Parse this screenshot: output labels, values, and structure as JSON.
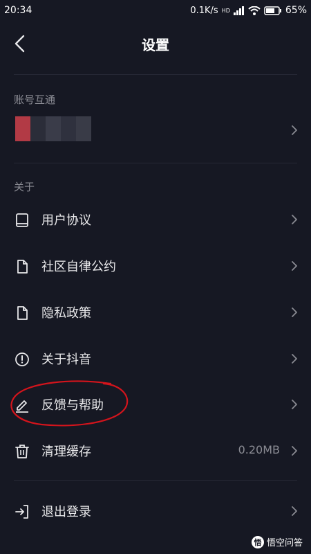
{
  "status_bar": {
    "time": "20:34",
    "net_speed": "0.1K/s",
    "network_badge": "HD",
    "battery": "65%"
  },
  "header": {
    "title": "设置"
  },
  "account_section": {
    "label": "账号互通"
  },
  "about_section": {
    "label": "关于",
    "items": [
      {
        "label": "用户协议",
        "icon": "book-icon"
      },
      {
        "label": "社区自律公约",
        "icon": "document-icon"
      },
      {
        "label": "隐私政策",
        "icon": "document-icon"
      },
      {
        "label": "关于抖音",
        "icon": "info-icon"
      },
      {
        "label": "反馈与帮助",
        "icon": "edit-icon"
      },
      {
        "label": "清理缓存",
        "icon": "trash-icon",
        "value": "0.20MB"
      }
    ]
  },
  "logout": {
    "label": "退出登录",
    "icon": "logout-icon"
  },
  "watermark": {
    "text": "悟空问答"
  },
  "colors": {
    "background": "#161823",
    "text": "#e8e8ea",
    "muted": "#8a8b93",
    "annotation_red": "#d4141c"
  }
}
